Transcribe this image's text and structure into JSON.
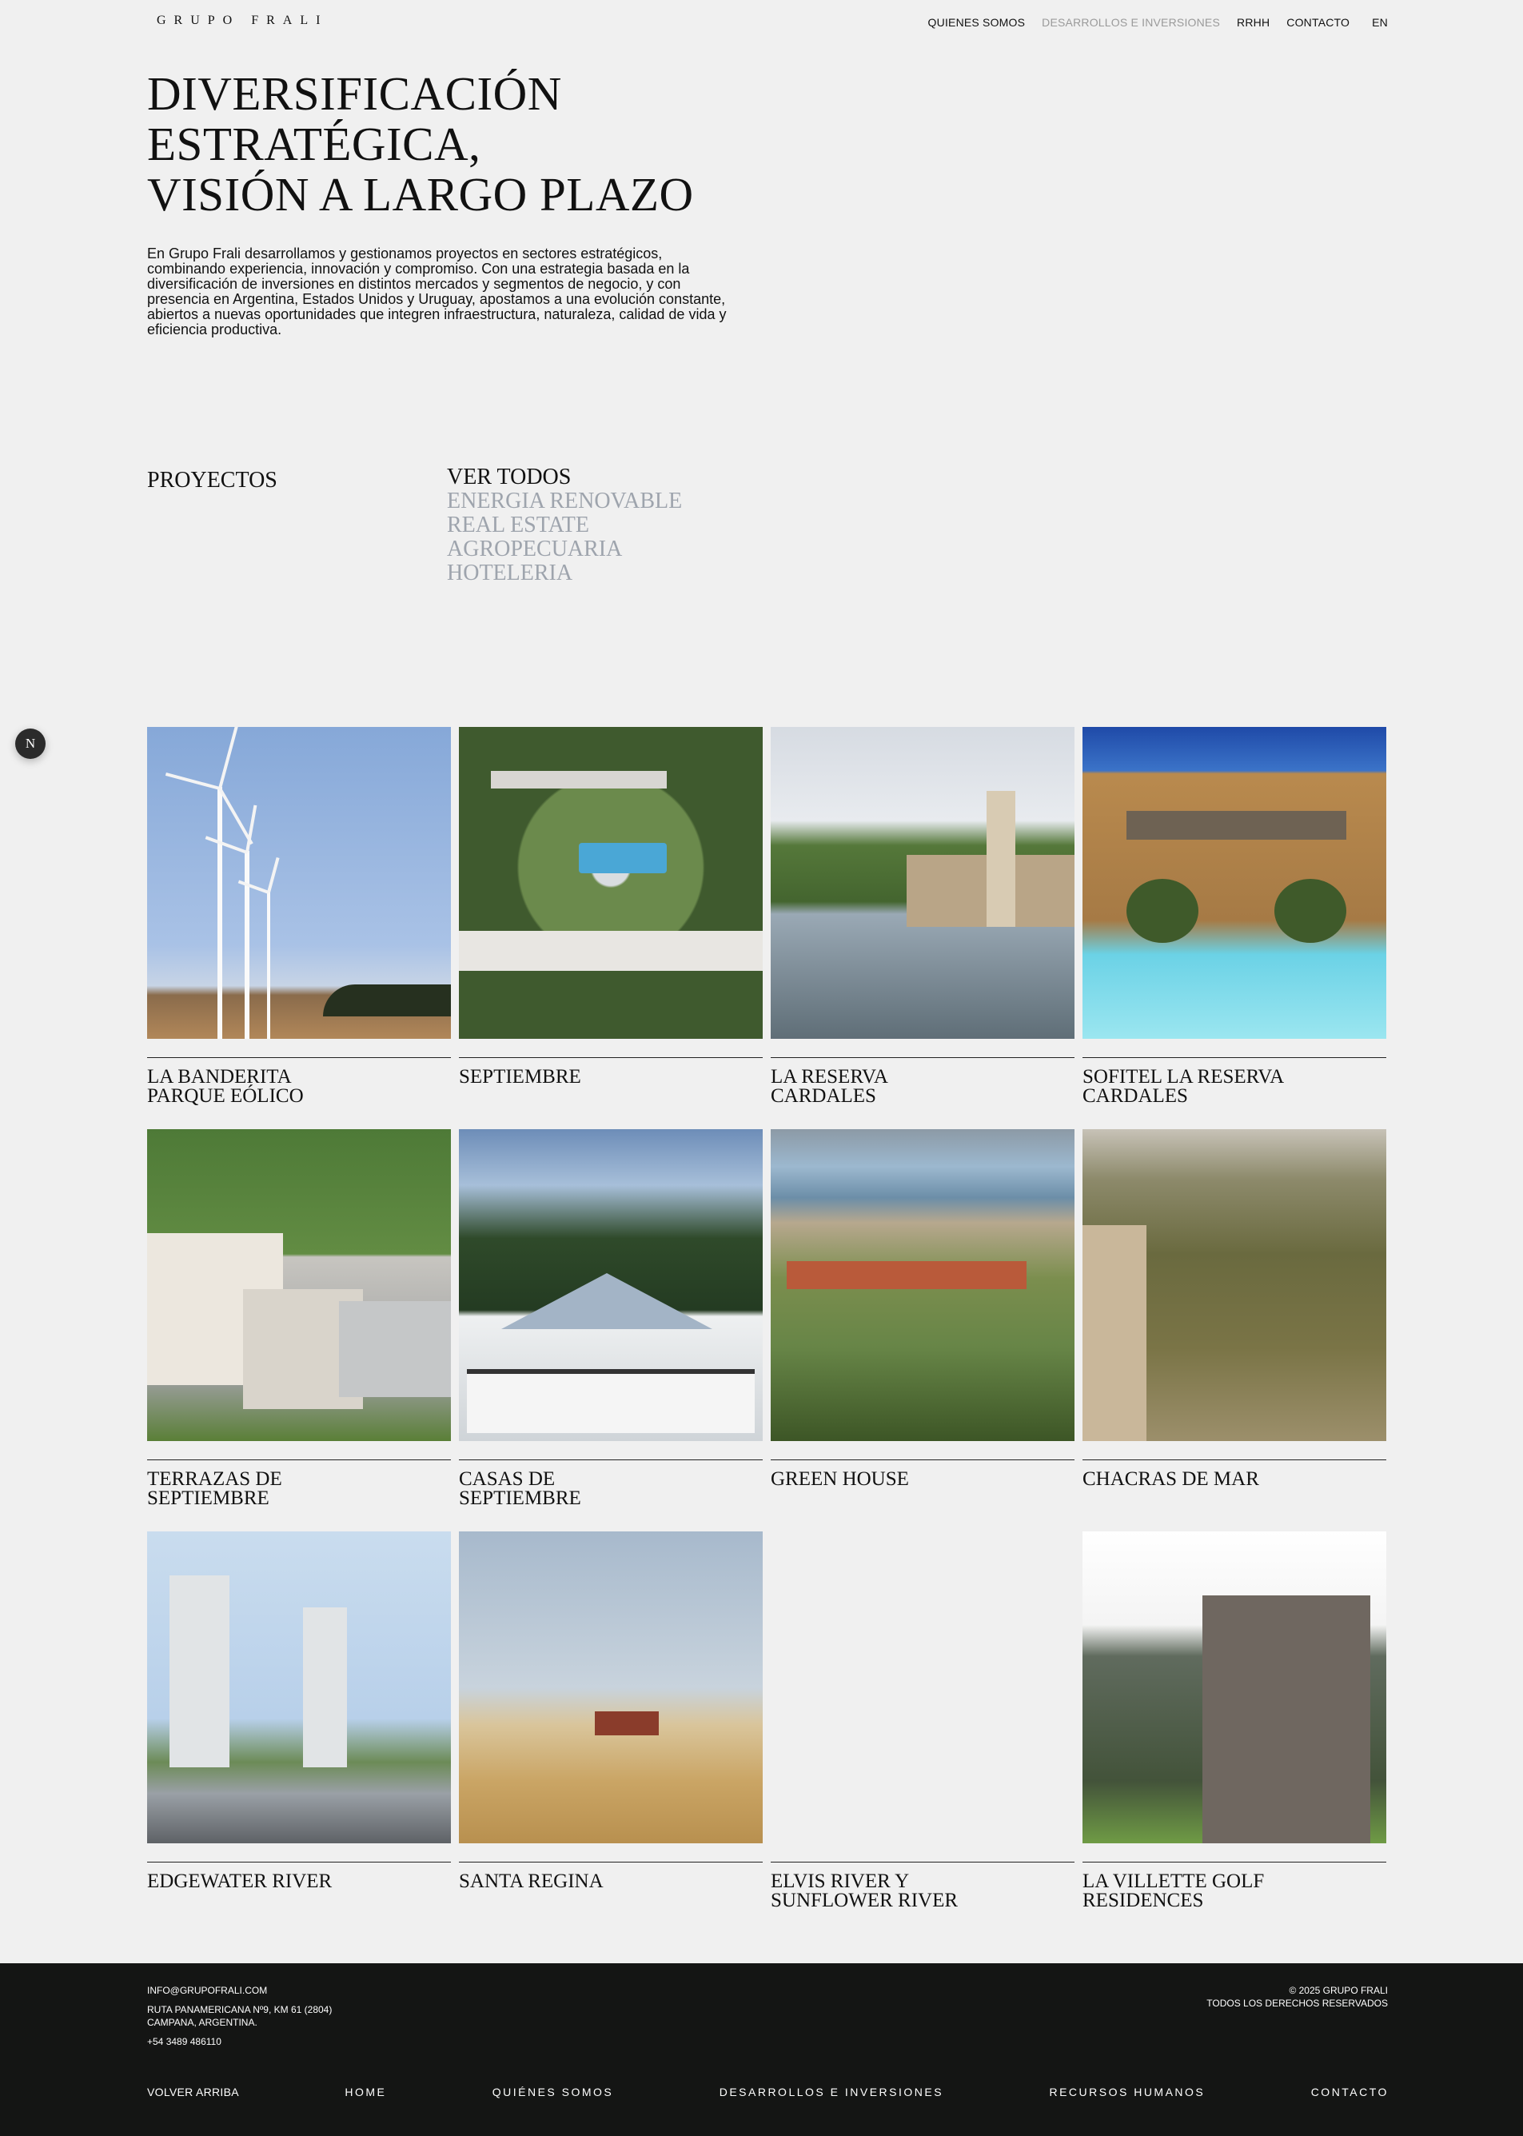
{
  "header": {
    "logo": "GRUPO FRALI",
    "nav": [
      {
        "label": "QUIENES SOMOS"
      },
      {
        "label": "DESARROLLOS E INVERSIONES"
      },
      {
        "label": "RRHH"
      },
      {
        "label": "CONTACTO"
      },
      {
        "label": "EN"
      }
    ]
  },
  "hero": {
    "title_lines": [
      "DIVERSIFICACIÓN",
      "ESTRATÉGICA,",
      "VISIÓN A LARGO PLAZO"
    ],
    "intro": "En Grupo Frali desarrollamos y gestionamos proyectos en sectores estratégicos, combinando experiencia, innovación y compromiso. Con una estrategia basada en la diversificación de inversiones en distintos mercados y segmentos de negocio, y con presencia en Argentina, Estados Unidos y Uruguay, apostamos a una evolución constante, abiertos a nuevas oportunidades que integren infraestructura, naturaleza, calidad de vida y eficiencia productiva."
  },
  "projects": {
    "label": "PROYECTOS",
    "filters": [
      "VER TODOS",
      "ENERGIA RENOVABLE",
      "REAL ESTATE",
      "AGROPECUARIA",
      "HOTELERIA"
    ],
    "items": [
      {
        "title": "LA BANDERITA\nPARQUE EÓLICO",
        "image": "wind-farm"
      },
      {
        "title": "SEPTIEMBRE",
        "image": "aerial-neighborhood"
      },
      {
        "title": "LA RESERVA\nCARDALES",
        "image": "lake-house"
      },
      {
        "title": "SOFITEL LA RESERVA\nCARDALES",
        "image": "hotel-pool"
      },
      {
        "title": "TERRAZAS DE\nSEPTIEMBRE",
        "image": "residential-buildings"
      },
      {
        "title": "CASAS DE\nSEPTIEMBRE",
        "image": "victorian-house"
      },
      {
        "title": "GREEN HOUSE",
        "image": "aerial-courts"
      },
      {
        "title": "CHACRAS DE MAR",
        "image": "dunes-houses"
      },
      {
        "title": "EDGEWATER RIVER",
        "image": "towers-street"
      },
      {
        "title": "SANTA REGINA",
        "image": "wheat-harvester"
      },
      {
        "title": "ELVIS RIVER Y\nSUNFLOWER RIVER",
        "image": "none"
      },
      {
        "title": "LA VILLETTE GOLF\nRESIDENCES",
        "image": "stone-towers"
      }
    ]
  },
  "badge": "N",
  "footer": {
    "email": "INFO@GRUPOFRALI.COM",
    "address_line1": "RUTA PANAMERICANA Nº9, KM 61 (2804)",
    "address_line2": "CAMPANA, ARGENTINA.",
    "phone": "+54 3489 486110",
    "copyright": "© 2025 GRUPO FRALI",
    "rights": "TODOS LOS DERECHOS RESERVADOS",
    "nav": [
      "VOLVER ARRIBA",
      "HOME",
      "QUIÉNES SOMOS",
      "DESARROLLOS E INVERSIONES",
      "RECURSOS HUMANOS",
      "CONTACTO"
    ]
  }
}
